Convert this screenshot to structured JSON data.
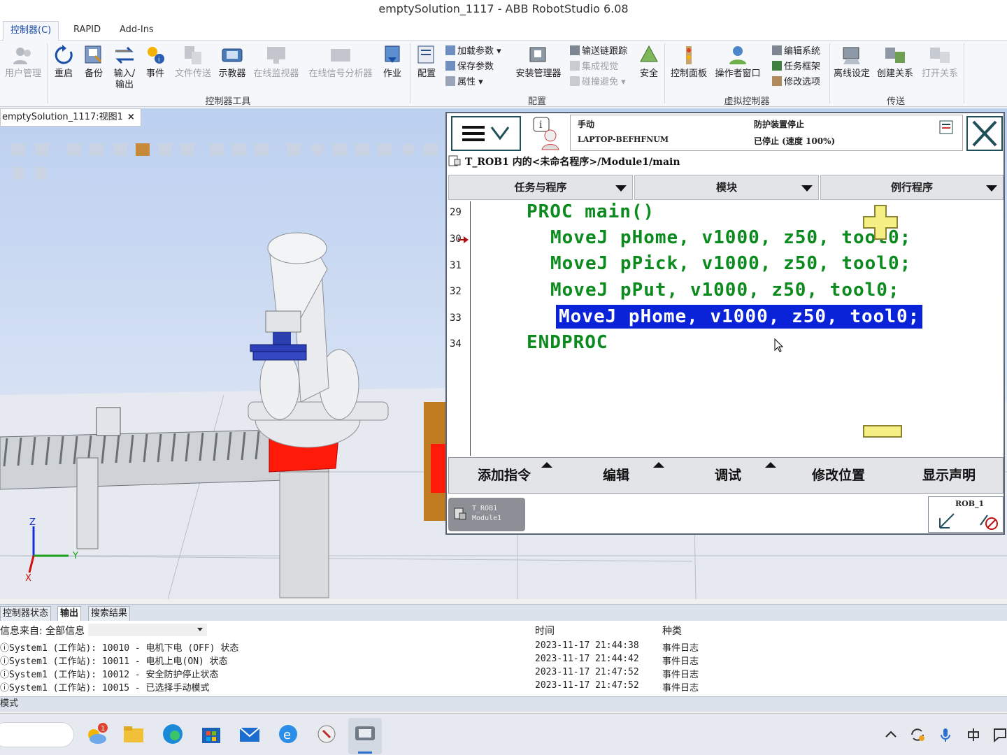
{
  "window": {
    "title": "emptySolution_1117 - ABB RobotStudio 6.08"
  },
  "ribbon_tabs": [
    {
      "label": "控制器(C)",
      "active": true
    },
    {
      "label": "RAPID",
      "active": false
    },
    {
      "label": "Add-Ins",
      "active": false
    }
  ],
  "ribbon": {
    "buttons": {
      "user_mgmt": "用户管理",
      "restart": "重启",
      "backup": "备份",
      "io1": "输入/",
      "io2": "输出",
      "events": "事件",
      "file_transfer": "文件传送",
      "teach_pendant": "示教器",
      "online_monitor": "在线监视器",
      "signal_analyzer": "在线信号分析器",
      "jobs": "作业",
      "config": "配置",
      "install_mgr": "安装管理器",
      "safety": "安全",
      "control_panel": "控制面板",
      "operator_window": "操作者窗口",
      "offline_setup": "离线设定",
      "create_relation": "创建关系",
      "open_relation": "打开关系"
    },
    "small": {
      "load_params": "加载参数",
      "save_params": "保存参数",
      "properties": "属性",
      "conveyor_tracking": "输送链跟踪",
      "integrated_vision": "集成视觉",
      "collision_avoid": "碰撞避免",
      "edit_system": "编辑系统",
      "task_frame": "任务框架",
      "modify_options": "修改选项"
    },
    "groups": {
      "controller_tools": "控制器工具",
      "configuration": "配置",
      "virtual_controller": "虚拟控制器",
      "transfer": "传送"
    }
  },
  "viewport": {
    "tab_label": "emptySolution_1117:视图1",
    "axis_z": "Z",
    "axis_y": "Y",
    "axis_x": "X"
  },
  "pendant": {
    "status": {
      "mode": "手动",
      "controller": "LAPTOP-BEFHFNUM",
      "state": "防护装置停止",
      "speed": "已停止 (速度 100%)"
    },
    "path": "T_ROB1 内的<未命名程序>/Module1/main",
    "columns": [
      "任务与程序",
      "模块",
      "例行程序"
    ],
    "code": [
      {
        "line": "29",
        "text": "PROC main()",
        "selected": false
      },
      {
        "line": "30",
        "text": "MoveJ pHome, v1000, z50, tool0;",
        "selected": false
      },
      {
        "line": "31",
        "text": "MoveJ pPick, v1000, z50, tool0;",
        "selected": false
      },
      {
        "line": "32",
        "text": "MoveJ pPut, v1000, z50, tool0;",
        "selected": false
      },
      {
        "line": "33",
        "text": "MoveJ pHome, v1000, z50, tool0;",
        "selected": true
      },
      {
        "line": "34",
        "text": "ENDPROC",
        "selected": false
      }
    ],
    "toolbar": [
      "添加指令",
      "编辑",
      "调试",
      "修改位置",
      "显示声明"
    ],
    "task": {
      "line1": "T_ROB1",
      "line2": "Module1"
    },
    "rob": "ROB_1"
  },
  "output": {
    "tabs": [
      {
        "label": "控制器状态",
        "active": false
      },
      {
        "label": "输出",
        "active": true
      },
      {
        "label": "搜索结果",
        "active": false
      }
    ],
    "filter_label": "信息来自: 全部信息",
    "headers": {
      "time": "时间",
      "category": "种类"
    },
    "rows": [
      {
        "msg": "System1 (工作站): 10010 - 电机下电 (OFF) 状态",
        "time": "2023-11-17 21:44:38",
        "cat": "事件日志"
      },
      {
        "msg": "System1 (工作站): 10011 - 电机上电(ON) 状态",
        "time": "2023-11-17 21:44:42",
        "cat": "事件日志"
      },
      {
        "msg": "System1 (工作站): 10012 - 安全防护停止状态",
        "time": "2023-11-17 21:47:52",
        "cat": "事件日志"
      },
      {
        "msg": "System1 (工作站): 10015 - 已选择手动模式",
        "time": "2023-11-17 21:47:52",
        "cat": "事件日志"
      }
    ]
  },
  "statusbar": {
    "text": "模式"
  },
  "taskbar": {
    "weather_badge": "1"
  }
}
